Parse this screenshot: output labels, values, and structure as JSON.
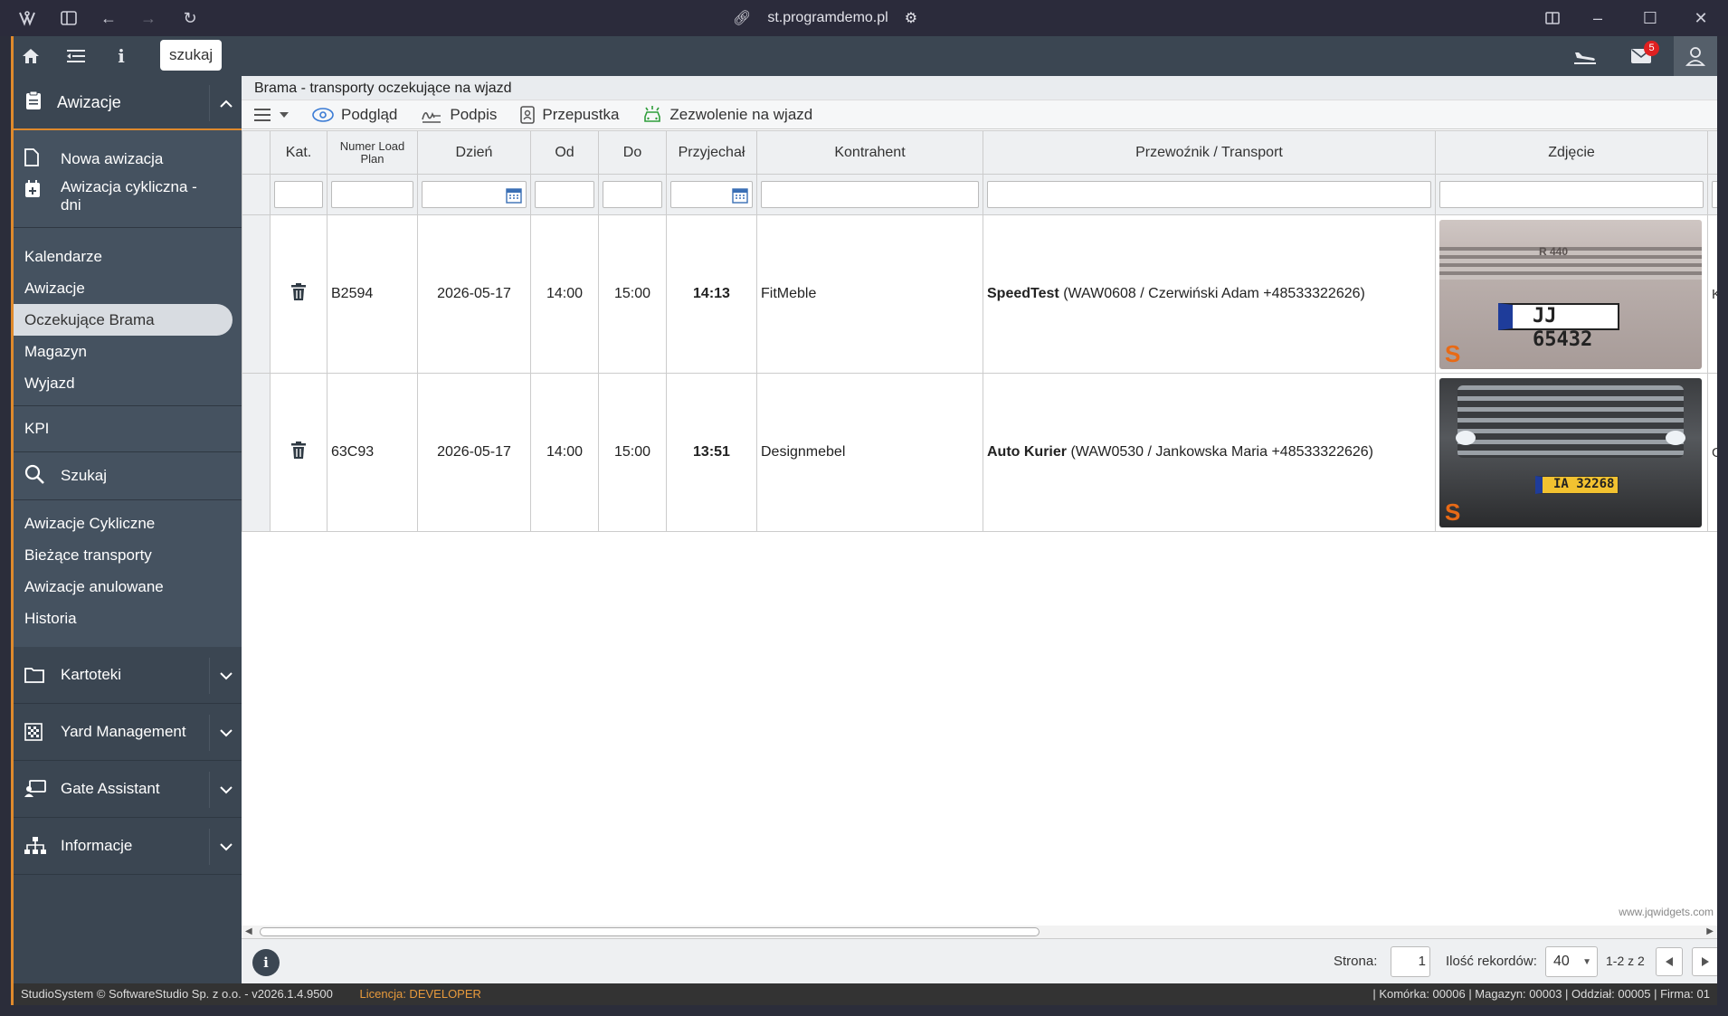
{
  "browser": {
    "url": "st.programdemo.pl"
  },
  "topbar": {
    "search_label": "szukaj",
    "mail_count": "5"
  },
  "sidebar": {
    "section_title": "Awizacje",
    "actions": [
      "Nowa awizacja",
      "Awizacja cykliczna - dni"
    ],
    "items_a": [
      "Kalendarze",
      "Awizacje",
      "Oczekujące Brama",
      "Magazyn",
      "Wyjazd"
    ],
    "active_item": "Oczekujące Brama",
    "kpi": "KPI",
    "search": "Szukaj",
    "items_b": [
      "Awizacje Cykliczne",
      "Bieżące transporty",
      "Awizacje anulowane",
      "Historia"
    ],
    "groups": [
      "Kartoteki",
      "Yard Management",
      "Gate Assistant",
      "Informacje"
    ]
  },
  "main": {
    "title": "Brama - transporty oczekujące na wjazd",
    "toolbar": [
      "Podgląd",
      "Podpis",
      "Przepustka",
      "Zezwolenie na wjazd"
    ]
  },
  "table": {
    "columns": [
      "Kat.",
      "Numer Load Plan",
      "Dzień",
      "Od",
      "Do",
      "Przyjechał",
      "Kontrahent",
      "Przewoźnik / Transport",
      "Zdjęcie"
    ],
    "rows": [
      {
        "load_plan": "B2594",
        "day": "2026-05-17",
        "from": "14:00",
        "to": "15:00",
        "arrived": "14:13",
        "contractor": "FitMeble",
        "carrier": "SpeedTest",
        "transport": "(WAW0608 / Czerwiński Adam +48533322626)",
        "plate": "JJ 65432",
        "truck_model": "R 440",
        "overflow": "K P"
      },
      {
        "load_plan": "63C93",
        "day": "2026-05-17",
        "from": "14:00",
        "to": "15:00",
        "arrived": "13:51",
        "contractor": "Designmebel",
        "carrier": "Auto Kurier",
        "transport": "(WAW0530 / Jankowska Maria +48533322626)",
        "plate": "IA 32268",
        "overflow": "G c"
      }
    ]
  },
  "footer": {
    "watermark": "www.jqwidgets.com",
    "page_label": "Strona:",
    "page_value": "1",
    "records_label": "Ilość rekordów:",
    "records_value": "40",
    "range": "1-2 z 2"
  },
  "statusbar": {
    "copyright": "StudioSystem © SoftwareStudio Sp. z o.o. - v2026.1.4.9500",
    "license": "Licencja: DEVELOPER",
    "right": "| Komórka: 00006 | Magazyn: 00003 | Oddział: 00005 | Firma: 01"
  }
}
